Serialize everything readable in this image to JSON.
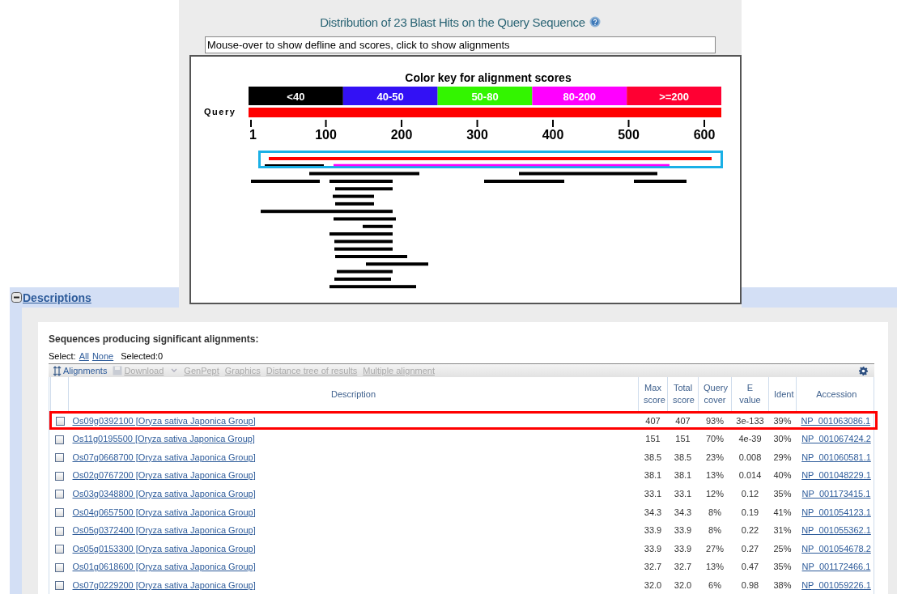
{
  "graphic": {
    "title": "Distribution of 23 Blast Hits on the Query Sequence",
    "info_box": "Mouse-over to show defline and scores, click to show alignments",
    "key_title": "Color key for alignment scores",
    "key": [
      {
        "label": "<40",
        "color": "#000000"
      },
      {
        "label": "40-50",
        "color": "#3311f5"
      },
      {
        "label": "50-80",
        "color": "#33f500"
      },
      {
        "label": "80-200",
        "color": "#ff00ff"
      },
      {
        "label": ">=200",
        "color": "#ff0033"
      }
    ],
    "query_label": "Query",
    "ticks": [
      "1",
      "100",
      "200",
      "300",
      "400",
      "500",
      "600"
    ]
  },
  "descriptions": {
    "title": "Descriptions",
    "expanded": true,
    "heading": "Sequences producing significant alignments:",
    "select_label": "Select:",
    "select_links": [
      "All",
      "None"
    ],
    "selected_count": "Selected:0",
    "toolbar": [
      {
        "label": "Alignments",
        "kind": "sort",
        "disabled": false
      },
      {
        "label": "Download",
        "kind": "download",
        "disabled": true
      },
      {
        "label": "GenPept",
        "kind": "link",
        "disabled": true
      },
      {
        "label": "Graphics",
        "kind": "link",
        "disabled": true
      },
      {
        "label": "Distance tree of results",
        "kind": "link",
        "disabled": true
      },
      {
        "label": "Multiple alignment",
        "kind": "link",
        "disabled": true
      }
    ],
    "columns": [
      "Description",
      "Max score",
      "Total score",
      "Query cover",
      "E value",
      "Ident",
      "Accession"
    ],
    "rows": [
      {
        "checked": false,
        "highlighted": true,
        "description": "Os09g0392100 [Oryza sativa Japonica Group]",
        "max_score": "407",
        "total_score": "407",
        "query_cover": "93%",
        "e_value": "3e-133",
        "ident": "39%",
        "accession": "NP_001063086.1"
      },
      {
        "checked": false,
        "highlighted": false,
        "description": "Os11g0195500 [Oryza sativa Japonica Group]",
        "max_score": "151",
        "total_score": "151",
        "query_cover": "70%",
        "e_value": "4e-39",
        "ident": "30%",
        "accession": "NP_001067424.2"
      },
      {
        "checked": false,
        "highlighted": false,
        "description": "Os07g0668700 [Oryza sativa Japonica Group]",
        "max_score": "38.5",
        "total_score": "38.5",
        "query_cover": "23%",
        "e_value": "0.008",
        "ident": "29%",
        "accession": "NP_001060581.1"
      },
      {
        "checked": false,
        "highlighted": false,
        "description": "Os02g0767200 [Oryza sativa Japonica Group]",
        "max_score": "38.1",
        "total_score": "38.1",
        "query_cover": "13%",
        "e_value": "0.014",
        "ident": "40%",
        "accession": "NP_001048229.1"
      },
      {
        "checked": false,
        "highlighted": false,
        "description": "Os03g0348800 [Oryza sativa Japonica Group]",
        "max_score": "33.1",
        "total_score": "33.1",
        "query_cover": "12%",
        "e_value": "0.12",
        "ident": "35%",
        "accession": "NP_001173415.1"
      },
      {
        "checked": false,
        "highlighted": false,
        "description": "Os04g0657500 [Oryza sativa Japonica Group]",
        "max_score": "34.3",
        "total_score": "34.3",
        "query_cover": "8%",
        "e_value": "0.19",
        "ident": "41%",
        "accession": "NP_001054123.1"
      },
      {
        "checked": false,
        "highlighted": false,
        "description": "Os05g0372400 [Oryza sativa Japonica Group]",
        "max_score": "33.9",
        "total_score": "33.9",
        "query_cover": "8%",
        "e_value": "0.22",
        "ident": "31%",
        "accession": "NP_001055362.1"
      },
      {
        "checked": false,
        "highlighted": false,
        "description": "Os05g0153300 [Oryza sativa Japonica Group]",
        "max_score": "33.9",
        "total_score": "33.9",
        "query_cover": "27%",
        "e_value": "0.27",
        "ident": "25%",
        "accession": "NP_001054678.2"
      },
      {
        "checked": false,
        "highlighted": false,
        "description": "Os01g0618600 [Oryza sativa Japonica Group]",
        "max_score": "32.7",
        "total_score": "32.7",
        "query_cover": "13%",
        "e_value": "0.47",
        "ident": "35%",
        "accession": "NP_001172466.1"
      },
      {
        "checked": false,
        "highlighted": false,
        "description": "Os07g0229200 [Oryza sativa Japonica Group]",
        "max_score": "32.0",
        "total_score": "32.0",
        "query_cover": "6%",
        "e_value": "0.98",
        "ident": "38%",
        "accession": "NP_001059226.1"
      }
    ]
  }
}
